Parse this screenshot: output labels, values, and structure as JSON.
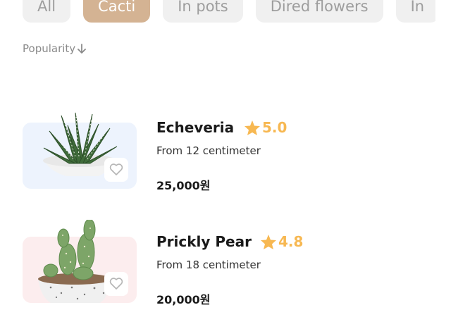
{
  "filters": {
    "chips": [
      {
        "label": "All",
        "active": false
      },
      {
        "label": "Cacti",
        "active": true
      },
      {
        "label": "In pots",
        "active": false
      },
      {
        "label": "Dired flowers",
        "active": false
      },
      {
        "label": "In",
        "active": false
      }
    ]
  },
  "sort": {
    "label": "Popularity",
    "icon": "arrow-down-icon"
  },
  "products": [
    {
      "name": "Echeveria",
      "rating": "5.0",
      "description": "From 12 centimeter",
      "price": "25,000원",
      "image_bg": "#edf3fd",
      "icon": "heart-icon"
    },
    {
      "name": "Prickly Pear",
      "rating": "4.8",
      "description": "From 18 centimeter",
      "price": "20,000원",
      "image_bg": "#fcedee",
      "icon": "heart-icon"
    }
  ],
  "colors": {
    "accent": "#d4b393",
    "star": "#f7b852"
  }
}
